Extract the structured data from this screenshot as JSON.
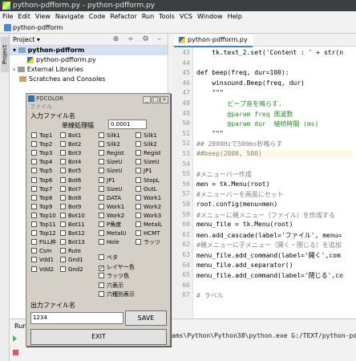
{
  "window": {
    "title": "python-pdfform.py - python-pdfform.py"
  },
  "menu": [
    "File",
    "Edit",
    "View",
    "Navigate",
    "Code",
    "Refactor",
    "Run",
    "Tools",
    "VCS",
    "Window",
    "Help"
  ],
  "nav": {
    "breadcrumb": "python-pdfform"
  },
  "sidestrip": {
    "project_tab": "Project"
  },
  "project": {
    "header": "Project ▾",
    "tree": [
      {
        "label": "python-pdfform",
        "type": "folder"
      },
      {
        "label": "python-pdfform.py",
        "type": "py"
      },
      {
        "label": "External Libraries",
        "type": "lib"
      },
      {
        "label": "Scratches and Consoles",
        "type": "scratch"
      }
    ]
  },
  "editor": {
    "tab": "python-pdfform.py",
    "lines": [
      {
        "n": "43",
        "code": "    tk.text_2.set('Content : ' + str(n"
      },
      {
        "n": "44",
        "code": ""
      },
      {
        "n": "45",
        "code": "def beep(freq, dur=100):"
      },
      {
        "n": "46",
        "code": "    winsound.Beep(freq, dur)"
      },
      {
        "n": "47",
        "code": "    \"\"\""
      },
      {
        "n": "48",
        "code": "        ビープ音を鳴らす."
      },
      {
        "n": "49",
        "code": "        @param freq 周波数"
      },
      {
        "n": "50",
        "code": "        @param dur  継続時間 (ms)"
      },
      {
        "n": "51",
        "code": "    \"\"\""
      },
      {
        "n": "52",
        "code": "## 2000Hzで500ms秒鳴らす"
      },
      {
        "n": "53",
        "code": "##beep(2000, 500)"
      },
      {
        "n": "54",
        "code": ""
      },
      {
        "n": "55",
        "code": "#メニューバー作成"
      },
      {
        "n": "56",
        "code": "men = tk.Menu(root)"
      },
      {
        "n": "57",
        "code": "#メニューバーを画面にセット"
      },
      {
        "n": "58",
        "code": "root.config(menu=men)"
      },
      {
        "n": "59",
        "code": "#メニューに親メニュー（ファイル）を作成する"
      },
      {
        "n": "60",
        "code": "menu_file = tk.Menu(root)"
      },
      {
        "n": "61",
        "code": "men.add_cascade(label='ファイル', menu="
      },
      {
        "n": "62",
        "code": "#親メニューに子メニュー（開く・閉じる）を追加"
      },
      {
        "n": "63",
        "code": "menu_file.add_command(label='開く',com"
      },
      {
        "n": "64",
        "code": "menu_file.add_separator()"
      },
      {
        "n": "65",
        "code": "menu_file.add_command(label='閉じる',co"
      },
      {
        "n": "66",
        "code": ""
      },
      {
        "n": "67",
        "code": "# ラベル"
      }
    ]
  },
  "run": {
    "label": "Run",
    "path": "ams\\Python\\Python38\\python.exe G:/TEXT/python-pdf"
  },
  "dialog": {
    "title": "PDCOLOR",
    "window_buttons": [
      "_",
      "□",
      "×"
    ],
    "menu_file": "ファイル",
    "input_label": "入力ファイル名",
    "unit_label": "単線処理幅",
    "unit_value": "0.0001",
    "checkboxes": [
      [
        "Top1",
        "Bot1",
        "Silk1",
        "Silk1"
      ],
      [
        "Top2",
        "Bot2",
        "Silk2",
        "Silk2"
      ],
      [
        "Top3",
        "Bot3",
        "Regist",
        "Regist"
      ],
      [
        "Top4",
        "Bot4",
        "SizeU",
        "SizeU"
      ],
      [
        "Top5",
        "Bot5",
        "SizeU",
        "JP1"
      ],
      [
        "Top6",
        "Bot6",
        "JP1",
        "StopL"
      ],
      [
        "Top7",
        "Bot7",
        "SizeU",
        "OutL"
      ],
      [
        "Top8",
        "Bot8",
        "DATA",
        "Work1"
      ],
      [
        "Top9",
        "Bot9",
        "Work1",
        "Work2"
      ],
      [
        "Top10",
        "Bot10",
        "Work2",
        "Work3"
      ],
      [
        "Top11",
        "Bot11",
        "P角度",
        "MetalL"
      ],
      [
        "Top12",
        "Bot12",
        "MetalU",
        "HCMT"
      ],
      [
        "FILL枠",
        "Bot13",
        "Hole",
        "ラッツ"
      ],
      [
        "Csm",
        "Rute",
        "",
        ""
      ],
      [
        "Vdd1",
        "Gnd1",
        "",
        ""
      ],
      [
        "Vdd2",
        "Gnd2",
        "",
        ""
      ]
    ],
    "options": [
      {
        "label": "ベタ",
        "checked": false
      },
      {
        "label": "レイヤー色",
        "checked": true
      },
      {
        "label": "ラッツ色",
        "checked": false
      },
      {
        "label": "穴表示",
        "checked": false
      },
      {
        "label": "穴種別表示",
        "checked": false
      }
    ],
    "output_label": "出力ファイル名",
    "output_value": "1234",
    "save_label": "SAVE",
    "exit_label": "EXIT"
  }
}
